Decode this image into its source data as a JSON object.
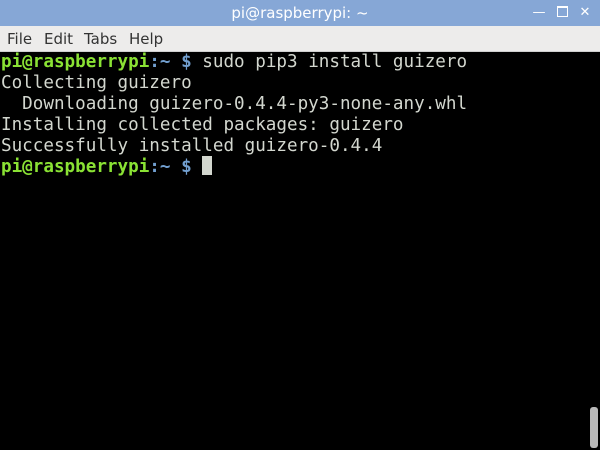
{
  "window": {
    "title": "pi@raspberrypi: ~",
    "minimize_glyph": "—",
    "close_glyph": "✕",
    "accent_color": "#86a7d6"
  },
  "menubar": {
    "items": [
      {
        "label": "File"
      },
      {
        "label": "Edit"
      },
      {
        "label": "Tabs"
      },
      {
        "label": "Help"
      }
    ]
  },
  "terminal": {
    "colors": {
      "user": "#8ae234",
      "path": "#729fcf",
      "text": "#d3d7cf",
      "background": "#000000"
    },
    "prompt_user": "pi@raspberrypi",
    "prompt_sep": ":",
    "prompt_path": "~",
    "prompt_symbol": "$",
    "command": "sudo pip3 install guizero",
    "output": [
      "Collecting guizero",
      "  Downloading guizero-0.4.4-py3-none-any.whl",
      "Installing collected packages: guizero",
      "Successfully installed guizero-0.4.4"
    ]
  }
}
